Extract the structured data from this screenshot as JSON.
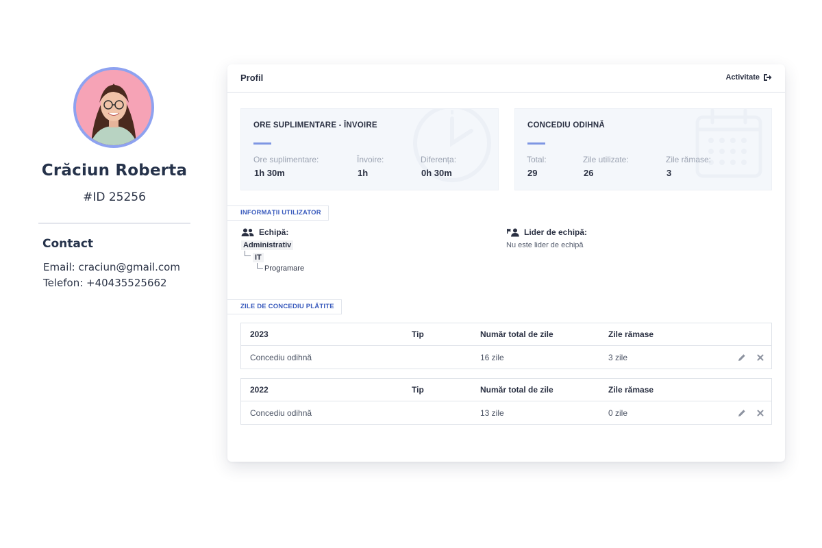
{
  "profile": {
    "name": "Crăciun Roberta",
    "id_label": "#ID 25256",
    "avatar_icon": "user-photo",
    "contact_title": "Contact",
    "email_line": "Email: craciun@gmail.com",
    "phone_line": "Telefon: +40435525662"
  },
  "header": {
    "title": "Profil",
    "activity_label": "Activitate",
    "activity_icon": "sign-out-icon"
  },
  "overtime": {
    "title": "ORE SUPLIMENTARE - ÎNVOIRE",
    "background_icon": "clock-icon",
    "stats": [
      {
        "label": "Ore suplimentare:",
        "value": "1h 30m"
      },
      {
        "label": "Învoire:",
        "value": "1h"
      },
      {
        "label": "Diferența:",
        "value": "0h 30m"
      }
    ]
  },
  "vacation": {
    "title": "CONCEDIU ODIHNĂ",
    "background_icon": "calendar-icon",
    "stats": [
      {
        "label": "Total:",
        "value": "29"
      },
      {
        "label": "Zile utilizate:",
        "value": "26"
      },
      {
        "label": "Zile rămase:",
        "value": "3"
      }
    ]
  },
  "user_info": {
    "section_label": "INFORMAȚII UTILIZATOR",
    "team_label": "Echipă:",
    "team_icon": "users-icon",
    "team_tree": [
      "Administrativ",
      "IT",
      "Programare"
    ],
    "leader_label": "Lider de echipă:",
    "leader_icon": "user-flag-icon",
    "leader_value": "Nu este lider de echipă"
  },
  "paid_leave": {
    "section_label": "ZILE DE CONCEDIU PLĂTITE",
    "columns": [
      "Tip",
      "Număr total de zile",
      "Zile rămase"
    ],
    "tables": [
      {
        "year": "2023",
        "type": "Concediu odihnă",
        "total": "16 zile",
        "remaining": "3 zile"
      },
      {
        "year": "2022",
        "type": "Concediu odihnă",
        "total": "13 zile",
        "remaining": "0 zile"
      }
    ]
  },
  "colors": {
    "accent": "#7e96e3",
    "section_link": "#3a5bbd",
    "avatar_ring": "#8ea2f0",
    "avatar_bg": "#f6a3b6",
    "stat_bg": "#f4f7fb"
  }
}
